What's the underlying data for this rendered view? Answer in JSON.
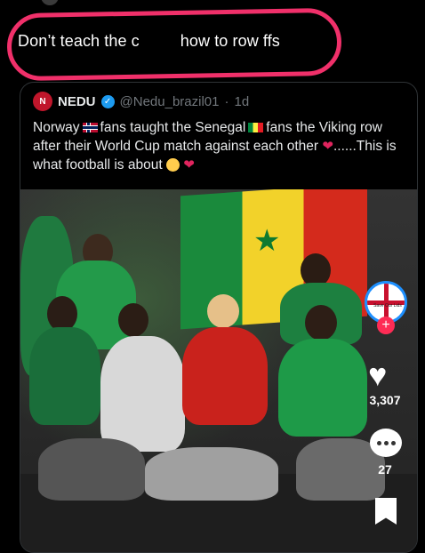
{
  "post": {
    "text_left": "Don’t teach the c",
    "text_right": "how to row ffs"
  },
  "quote": {
    "avatar_text": "N",
    "name": "NEDU",
    "handle": "@Nedu_brazil01",
    "separator": "·",
    "time": "1d",
    "text_1": "Norway",
    "text_2": "fans taught the Senegal",
    "text_3": "fans the Viking row after their World Cup match against each other",
    "text_4": "......This is what football is about"
  },
  "video_overlay": {
    "avatar_label": "Save Our Lids",
    "likes": "3,307",
    "comments": "27"
  },
  "colors": {
    "highlight": "#f0306a",
    "verified": "#1d9bf0",
    "heart": "#e0245e",
    "follow_plus": "#fe2c55"
  }
}
